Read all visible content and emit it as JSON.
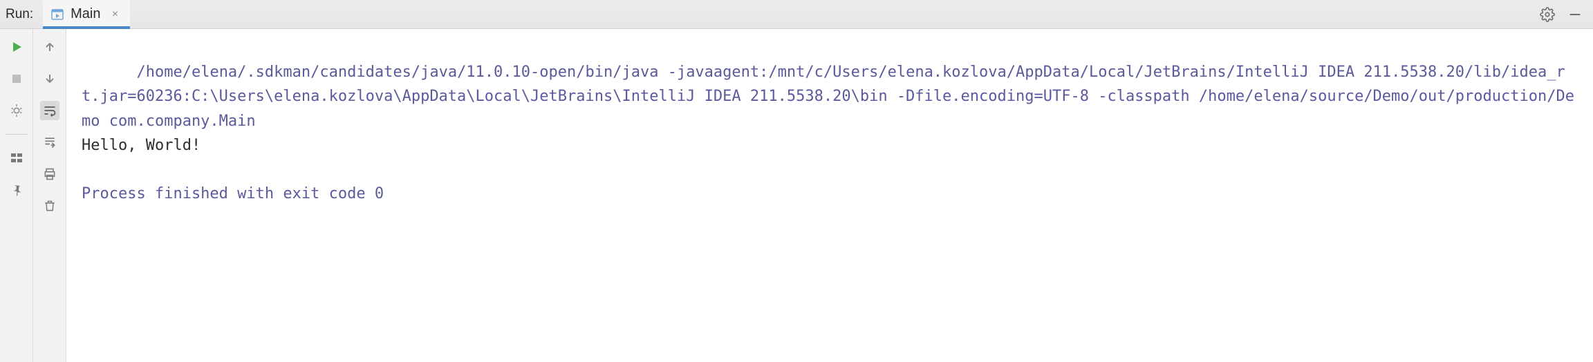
{
  "header": {
    "panel_label": "Run:",
    "tab": {
      "label": "Main",
      "close_glyph": "×"
    }
  },
  "left_gutter": {
    "run_title": "Run",
    "stop_title": "Stop",
    "debug_title": "Rerun with debug",
    "layout_title": "Layout",
    "pin_title": "Pin tab"
  },
  "inner_gutter": {
    "up_title": "Up the stack trace",
    "down_title": "Down the stack trace",
    "wrap_title": "Soft-wrap",
    "scroll_title": "Scroll to end",
    "print_title": "Print",
    "trash_title": "Clear all"
  },
  "console": {
    "command": "/home/elena/.sdkman/candidates/java/11.0.10-open/bin/java -javaagent:/mnt/c/Users/elena.kozlova/AppData/Local/JetBrains/IntelliJ IDEA 211.5538.20/lib/idea_rt.jar=60236:C:\\Users\\elena.kozlova\\AppData\\Local\\JetBrains\\IntelliJ IDEA 211.5538.20\\bin -Dfile.encoding=UTF-8 -classpath /home/elena/source/Demo/out/production/Demo com.company.Main",
    "stdout": "Hello, World!",
    "exit_line": "Process finished with exit code 0"
  }
}
